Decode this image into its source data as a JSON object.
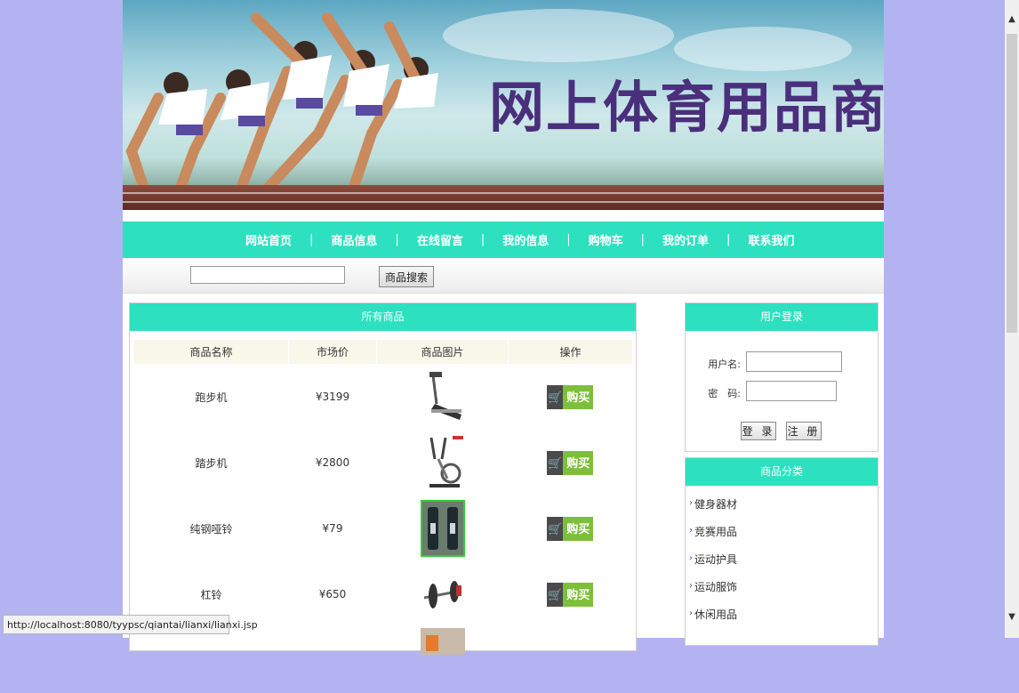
{
  "banner": {
    "title": "网上体育用品商城"
  },
  "nav": {
    "items": [
      "网站首页",
      "商品信息",
      "在线留言",
      "我的信息",
      "购物车",
      "我的订单",
      "联系我们"
    ]
  },
  "search": {
    "value": "",
    "button_label": "商品搜索"
  },
  "products": {
    "heading": "所有商品",
    "columns": [
      "商品名称",
      "市场价",
      "商品图片",
      "操作"
    ],
    "rows": [
      {
        "name": "跑步机",
        "price": "¥3199",
        "image_icon": "treadmill-image"
      },
      {
        "name": "踏步机",
        "price": "¥2800",
        "image_icon": "elliptical-image"
      },
      {
        "name": "纯钢哑铃",
        "price": "¥79",
        "image_icon": "dumbbell-image"
      },
      {
        "name": "杠铃",
        "price": "¥650",
        "image_icon": "barbell-image"
      }
    ],
    "buy_label": "购买"
  },
  "login": {
    "heading": "用户登录",
    "username_label": "用户名:",
    "password_label": "密　码:",
    "login_button": "登 录",
    "register_button": "注 册"
  },
  "categories": {
    "heading": "商品分类",
    "items": [
      "健身器材",
      "竞赛用品",
      "运动护具",
      "运动服饰",
      "休闲用品"
    ]
  },
  "status_bar": {
    "url": "http://localhost:8080/tyypsc/qiantai/lianxi/lianxi.jsp"
  },
  "colors": {
    "accent": "#2de0c0",
    "page_background": "#b3b3f2",
    "title_purple": "#4a2f7c",
    "buy_green": "#7dbf3a"
  }
}
